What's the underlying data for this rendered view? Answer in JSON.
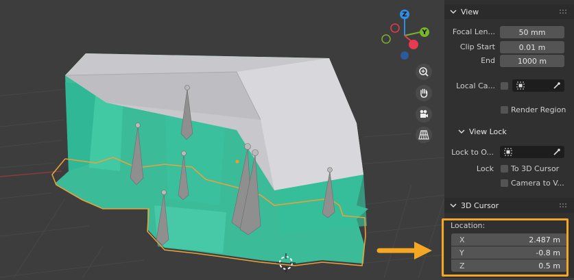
{
  "view_section": {
    "title": "View",
    "focal_length_label": "Focal Len...",
    "focal_length_value": "50 mm",
    "clip_start_label": "Clip Start",
    "clip_start_value": "0.01 m",
    "end_label": "End",
    "end_value": "1000 m",
    "local_camera_label": "Local Ca...",
    "render_region_label": "Render Region"
  },
  "view_lock": {
    "title": "View Lock",
    "lock_to_object_label": "Lock to O...",
    "lock_label": "Lock",
    "to_3d_cursor_label": "To 3D Cursor",
    "camera_to_view_label": "Camera to V..."
  },
  "cursor_section": {
    "title": "3D Cursor",
    "location_label": "Location:",
    "axes": [
      {
        "axis": "X",
        "value": "2.487 m"
      },
      {
        "axis": "Y",
        "value": "-0.8 m"
      },
      {
        "axis": "Z",
        "value": "0.5 m"
      }
    ]
  },
  "gizmo": {
    "z_label": "Z",
    "y_label": "Y"
  },
  "colors": {
    "accent_orange": "#f5a623",
    "selection_outline": "#e8a23a",
    "mesh_teal": "#3cc9a3",
    "axis_x": "#e83b4f",
    "axis_y": "#7ab32d",
    "axis_z": "#2d8ee8"
  },
  "icons": [
    "zoom-icon",
    "hand-pan-icon",
    "camera-icon",
    "grid-perspective-icon",
    "eyedropper-icon",
    "object-picker-icon",
    "chevron-down-icon",
    "arrow-icon",
    "3d-cursor-icon"
  ]
}
